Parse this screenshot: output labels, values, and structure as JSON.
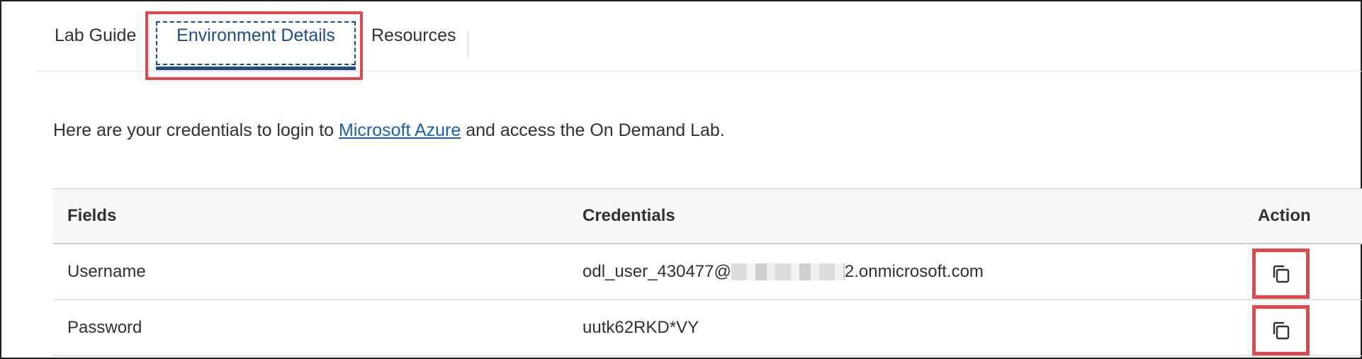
{
  "tabs": {
    "lab_guide": "Lab Guide",
    "environment_details": "Environment Details",
    "resources": "Resources"
  },
  "intro": {
    "before_link": "Here are your credentials to login to ",
    "link_text": "Microsoft Azure",
    "after_link": " and access the On Demand Lab."
  },
  "table": {
    "headers": {
      "fields": "Fields",
      "credentials": "Credentials",
      "action": "Action"
    },
    "rows": [
      {
        "field": "Username",
        "value_prefix": "odl_user_430477@",
        "value_suffix": "2.onmicrosoft.com"
      },
      {
        "field": "Password",
        "value": "uutk62RKD*VY"
      }
    ]
  },
  "colors": {
    "accent": "#1b4d8c",
    "link": "#1b60b0",
    "highlight": "#e8454b"
  },
  "icons": {
    "copy": "copy-icon"
  }
}
